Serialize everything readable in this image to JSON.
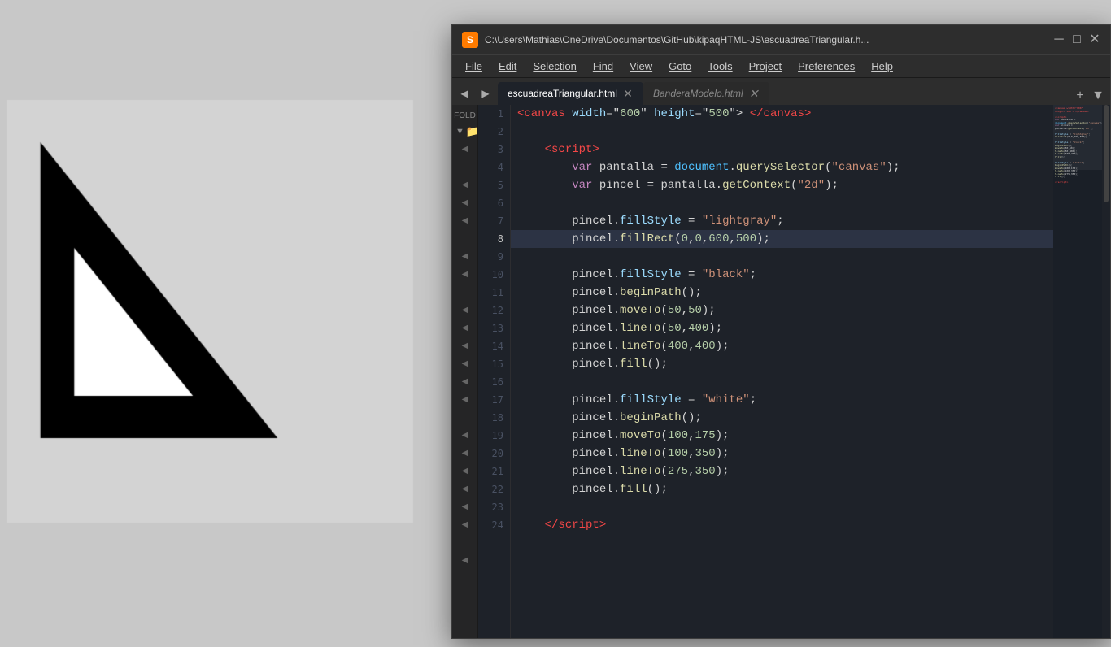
{
  "preview": {
    "bg": "#c8c8c8"
  },
  "window": {
    "title": "C:\\Users\\Mathias\\OneDrive\\Documentos\\GitHub\\kipaqHTML-JS\\escuadreaTriangular.h...",
    "icon": "S"
  },
  "menu": {
    "items": [
      "File",
      "Edit",
      "Selection",
      "Find",
      "View",
      "Goto",
      "Tools",
      "Project",
      "Preferences",
      "Help"
    ]
  },
  "tabs": [
    {
      "label": "escuadreaTriangular.html",
      "active": true
    },
    {
      "label": "BanderaModelo.html",
      "active": false
    }
  ],
  "sidebar": {
    "header": "FOLD",
    "folder_icon": "📁"
  },
  "code": {
    "lines": [
      {
        "num": 1,
        "content": "canvas_tag_open"
      },
      {
        "num": 2,
        "content": "empty"
      },
      {
        "num": 3,
        "content": "script_tag_open"
      },
      {
        "num": 4,
        "content": "var_pantalla"
      },
      {
        "num": 5,
        "content": "var_pincel"
      },
      {
        "num": 6,
        "content": "empty"
      },
      {
        "num": 7,
        "content": "fill_style_lightgray"
      },
      {
        "num": 8,
        "content": "fill_rect_lightgray",
        "highlighted": true
      },
      {
        "num": 9,
        "content": "empty"
      },
      {
        "num": 10,
        "content": "fill_style_black"
      },
      {
        "num": 11,
        "content": "begin_path_1"
      },
      {
        "num": 12,
        "content": "move_to_50_50"
      },
      {
        "num": 13,
        "content": "line_to_50_400"
      },
      {
        "num": 14,
        "content": "line_to_400_400"
      },
      {
        "num": 15,
        "content": "fill_1"
      },
      {
        "num": 16,
        "content": "empty"
      },
      {
        "num": 17,
        "content": "fill_style_white"
      },
      {
        "num": 18,
        "content": "begin_path_2"
      },
      {
        "num": 19,
        "content": "move_to_100_175"
      },
      {
        "num": 20,
        "content": "line_to_100_350"
      },
      {
        "num": 21,
        "content": "line_to_275_350"
      },
      {
        "num": 22,
        "content": "fill_2"
      },
      {
        "num": 23,
        "content": "empty"
      },
      {
        "num": 24,
        "content": "script_tag_close"
      }
    ]
  }
}
